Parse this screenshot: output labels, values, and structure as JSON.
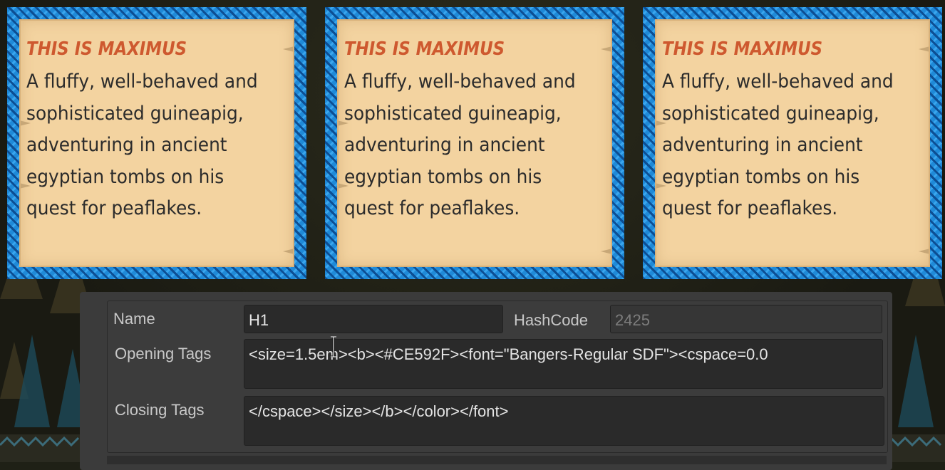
{
  "cards": [
    {
      "title": "THIS IS MAXIMUS",
      "lines": [
        "A fluffy, well-behaved and",
        "sophisticated guineapig,",
        "adventuring in ancient",
        "egyptian tombs on his",
        "quest for peaflakes."
      ]
    },
    {
      "title": "THIS IS MAXIMUS",
      "lines": [
        "A fluffy, well-behaved and",
        "sophisticated guineapig,",
        "adventuring in ancient",
        "egyptian tombs on his",
        "quest for peaflakes."
      ]
    },
    {
      "title": "THIS IS MAXIMUS",
      "lines": [
        "A fluffy, well-behaved and",
        "sophisticated guineapig,",
        "adventuring in ancient",
        "egyptian tombs on his",
        "quest for peaflakes."
      ]
    }
  ],
  "inspector": {
    "name_label": "Name",
    "name_value": "H1",
    "hashcode_label": "HashCode",
    "hashcode_value": "2425",
    "opening_tags_label": "Opening Tags",
    "opening_tags_value": "<size=1.5em><b><#CE592F><font=\"Bangers-Regular SDF\"><cspace=0.0",
    "closing_tags_label": "Closing Tags",
    "closing_tags_value": "</cspace></size></b></color></font>"
  },
  "colors": {
    "title_accent": "#CE592F",
    "card_border": "#1F8AD8",
    "card_paper": "#F3D3A0"
  },
  "icons": {
    "text_cursor": "i-beam-cursor-icon"
  }
}
